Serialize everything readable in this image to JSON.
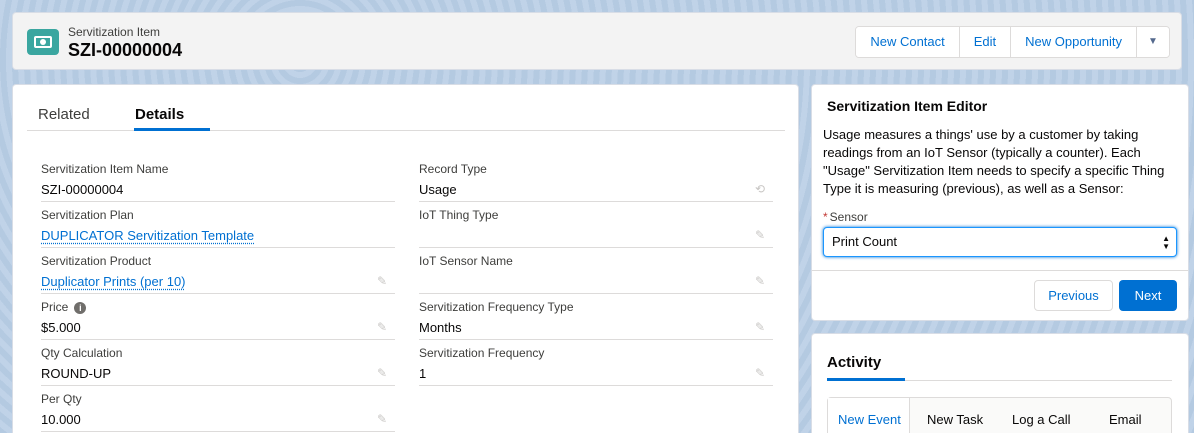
{
  "header": {
    "object_label": "Servitization Item",
    "record_name": "SZI-00000004",
    "icon": "servitization-item-icon",
    "actions": [
      "New Contact",
      "Edit",
      "New Opportunity"
    ]
  },
  "details": {
    "tabs": [
      "Related",
      "Details"
    ],
    "active_tab": "Details",
    "fields": {
      "item_name": {
        "label": "Servitization Item Name",
        "value": "SZI-00000004"
      },
      "plan": {
        "label": "Servitization Plan",
        "value": "DUPLICATOR Servitization Template"
      },
      "product": {
        "label": "Servitization Product",
        "value": "Duplicator Prints (per 10)"
      },
      "price": {
        "label": "Price",
        "value": "$5.000"
      },
      "qty_calc": {
        "label": "Qty Calculation",
        "value": "ROUND-UP"
      },
      "per_qty": {
        "label": "Per Qty",
        "value": "10.000"
      },
      "record_type": {
        "label": "Record Type",
        "value": "Usage"
      },
      "thing_type": {
        "label": "IoT Thing Type",
        "value": ""
      },
      "sensor_name": {
        "label": "IoT Sensor Name",
        "value": ""
      },
      "freq_type": {
        "label": "Servitization Frequency Type",
        "value": "Months"
      },
      "frequency": {
        "label": "Servitization Frequency",
        "value": "1"
      }
    }
  },
  "editor": {
    "title": "Servitization Item Editor",
    "description": "Usage measures a things' use by a customer by taking readings from an IoT Sensor (typically a counter). Each \"Usage\" Servitization Item needs to specify a specific Thing Type it is measuring (previous), as well as a Sensor:",
    "sensor_label": "Sensor",
    "sensor_value": "Print Count",
    "previous_label": "Previous",
    "next_label": "Next"
  },
  "activity": {
    "title": "Activity",
    "tabs": [
      "New Event",
      "New Task",
      "Log a Call",
      "Email"
    ]
  },
  "colors": {
    "brand": "#0070d2",
    "icon_bg": "#3aa6a0"
  }
}
